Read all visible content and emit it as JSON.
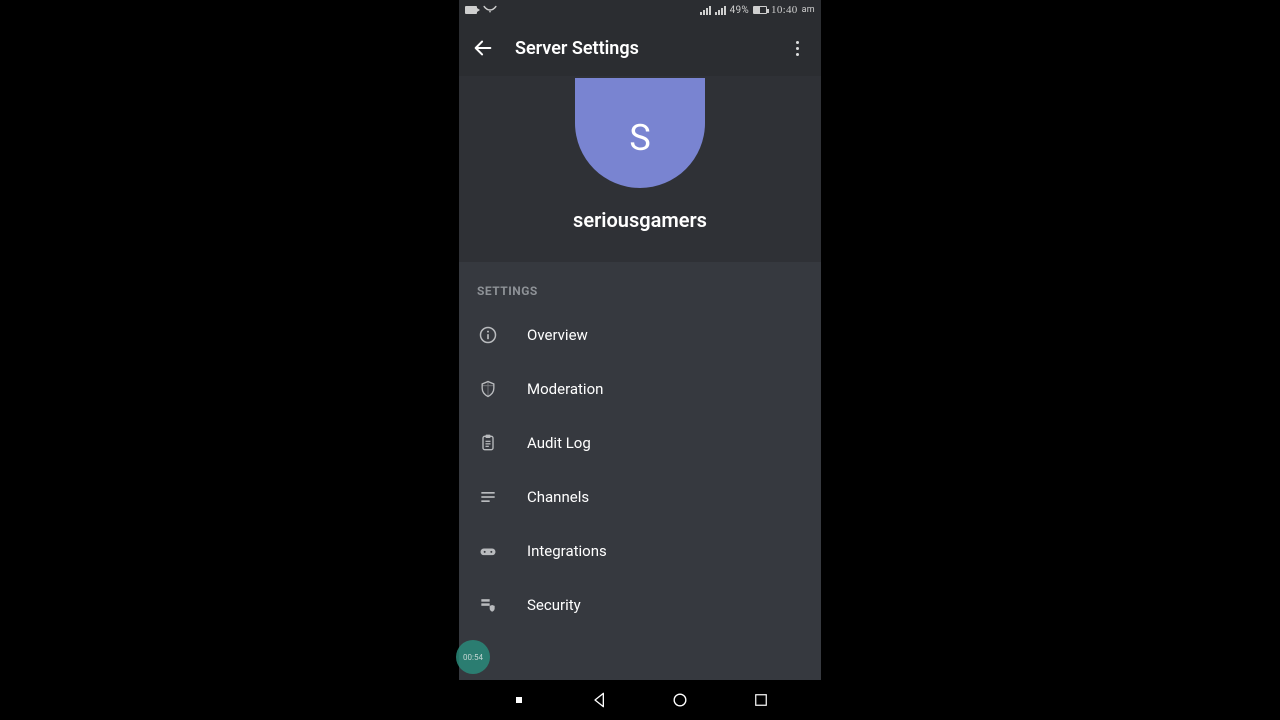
{
  "status_bar": {
    "battery_pct": "49%",
    "time": "10:40",
    "ampm": "am"
  },
  "app_bar": {
    "title": "Server Settings"
  },
  "server": {
    "avatar_letter": "S",
    "name": "seriousgamers"
  },
  "section_label": "SETTINGS",
  "items": {
    "overview": "Overview",
    "moderation": "Moderation",
    "audit_log": "Audit Log",
    "channels": "Channels",
    "integrations": "Integrations",
    "security": "Security"
  },
  "overlay_time": "00:54"
}
